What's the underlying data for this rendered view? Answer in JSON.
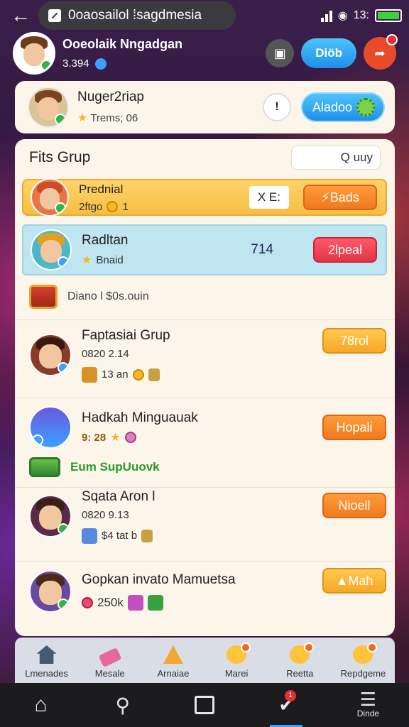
{
  "browser": {
    "back_icon": "arrow-left-icon",
    "url": "0oaosailol ⁞sagdmesia",
    "status_time": "13:",
    "battery_color": "#3bd13b"
  },
  "profile": {
    "name": "Ooeolaik Nngadgan",
    "level": "3.394",
    "btn_bag": "bag-icon",
    "btn_pill_label": "Diöb",
    "btn_share": "share-icon"
  },
  "player_card": {
    "name": "Nuger2riap",
    "sub": "Trems; 06",
    "info_icon": "info-icon",
    "add_label": "Aladoo"
  },
  "group": {
    "title": "Fits Grup",
    "search_placeholder": "Q uuy"
  },
  "rows": [
    {
      "title": "Prednial",
      "sub": "2ftgo",
      "sub_num": "1",
      "tag": "X E:",
      "button": "Bads"
    },
    {
      "title": "Radltan",
      "sub": "Bnaid",
      "tag": "714",
      "button": "2lpeal"
    },
    {
      "title": "Diano l $0s.ouin"
    },
    {
      "title": "Faptasiai Grup",
      "sub": "0820 2.14",
      "extra": "13 an",
      "button": "78rol"
    },
    {
      "title": "Hadkah Minguauak",
      "sub": "9: 28",
      "button": "Hopali"
    },
    {
      "title": "Eum SupUuovk"
    },
    {
      "title": "Sqata Aron l",
      "sub": "0820 9.13",
      "extra": "$4 tat b",
      "button": "Nioell"
    },
    {
      "title": "Gopkan invato Mamuetsa",
      "sub": "250k",
      "button": "Mah"
    }
  ],
  "tabs": [
    {
      "label": "Lmenades",
      "icon": "house-icon"
    },
    {
      "label": "Mesale",
      "icon": "eraser-icon"
    },
    {
      "label": "Arnaiae",
      "icon": "flag-icon"
    },
    {
      "label": "Marei",
      "icon": "emoji-icon"
    },
    {
      "label": "Reetta",
      "icon": "emoji-icon"
    },
    {
      "label": "Repdgeme",
      "icon": "emoji-icon"
    }
  ],
  "nav": [
    {
      "icon": "home-icon"
    },
    {
      "icon": "search-icon"
    },
    {
      "icon": "chat-icon"
    },
    {
      "icon": "game-icon",
      "badge": "1"
    },
    {
      "icon": "menu-icon",
      "label": "Dinde"
    }
  ]
}
